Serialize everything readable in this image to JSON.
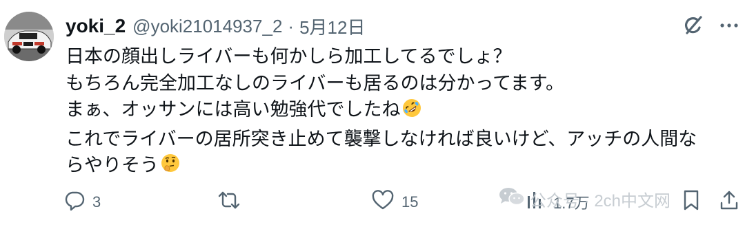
{
  "post": {
    "display_name": "yoki_2",
    "handle": "@yoki21014937_2",
    "separator": "·",
    "date": "5月12日",
    "lines": [
      "日本の顔出しライバーも何かしら加工してるでしょ？",
      "もちろん完全加工なしのライバーも居るのは分かってます。",
      "まぁ、オッサンには高い勉強代でしたね",
      "これでライバーの居所突き止めて襲撃しなければ良いけど、アッチの人間な",
      "らやりそう"
    ],
    "line3_emoji": "rolling-on-the-floor-laughing",
    "line5_emoji": "thinking-face"
  },
  "header_icons": [
    "grok-icon",
    "more-icon"
  ],
  "actions": {
    "replies": "3",
    "reposts": "",
    "likes": "15",
    "views": "1.7万"
  },
  "watermark": {
    "text": "公众号 · 2ch中文网",
    "icon": "wechat-icon"
  },
  "colors": {
    "text": "#0f1419",
    "muted": "#536471",
    "watermark": "#c2c8ce",
    "emoji": "#ffc83d"
  }
}
